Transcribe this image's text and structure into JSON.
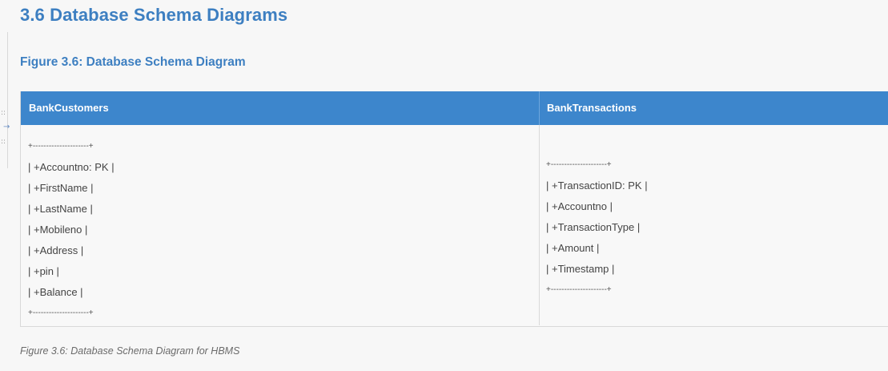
{
  "section_title": "3.6 Database Schema Diagrams",
  "figure_title": "Figure 3.6: Database Schema Diagram",
  "gutter": {
    "icons": [
      "drag-handle-icon",
      "arrow-right-icon",
      "drag-handle-icon"
    ],
    "glyphs": [
      "::",
      "→",
      "::"
    ]
  },
  "table": {
    "headers": [
      "BankCustomers",
      "BankTransactions"
    ],
    "bank_customers": [
      "+---------------------+",
      "| +Accountno: PK |",
      "| +FirstName |",
      "| +LastName |",
      "| +Mobileno |",
      "| +Address |",
      "| +pin |",
      "| +Balance |",
      "+---------------------+"
    ],
    "bank_transactions": [
      "+---------------------+",
      "| +TransactionID: PK |",
      "| +Accountno |",
      "| +TransactionType |",
      "| +Amount |",
      "| +Timestamp |",
      "+---------------------+"
    ]
  },
  "caption": "Figure 3.6: Database Schema Diagram for HBMS",
  "colors": {
    "heading": "#3d7fc1",
    "table_header_bg": "#3d86cc",
    "table_header_text": "#ffffff",
    "body_text": "#444444",
    "caption_text": "#6b6b6b"
  }
}
